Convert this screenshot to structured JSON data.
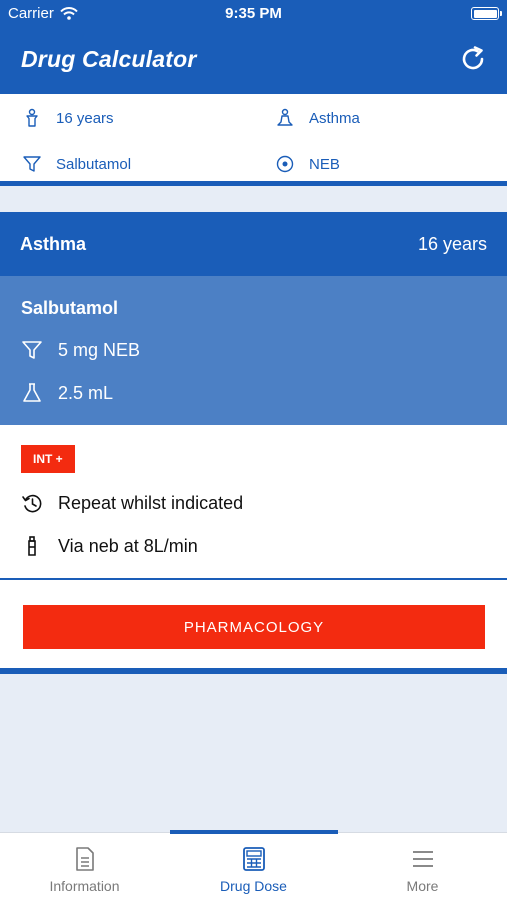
{
  "status_bar": {
    "carrier": "Carrier",
    "time": "9:35 PM"
  },
  "nav": {
    "title": "Drug Calculator",
    "refresh_icon": "refresh-icon"
  },
  "summary": {
    "age": "16 years",
    "condition": "Asthma",
    "drug": "Salbutamol",
    "route": "NEB"
  },
  "card": {
    "condition": "Asthma",
    "age": "16 years",
    "drug_name": "Salbutamol",
    "dose": "5 mg NEB",
    "volume": "2.5 mL"
  },
  "notes": {
    "badge": "INT +",
    "repeat": "Repeat whilst indicated",
    "delivery": "Via neb at 8L/min"
  },
  "action": {
    "pharmacology_label": "PHARMACOLOGY"
  },
  "tabs": [
    {
      "label": "Information",
      "icon": "document-icon"
    },
    {
      "label": "Drug Dose",
      "icon": "calculator-icon"
    },
    {
      "label": "More",
      "icon": "menu-icon"
    }
  ],
  "colors": {
    "primary": "#1a5db8",
    "secondary": "#4c80c5",
    "accent": "#f32b10",
    "background": "#e7edf6"
  }
}
